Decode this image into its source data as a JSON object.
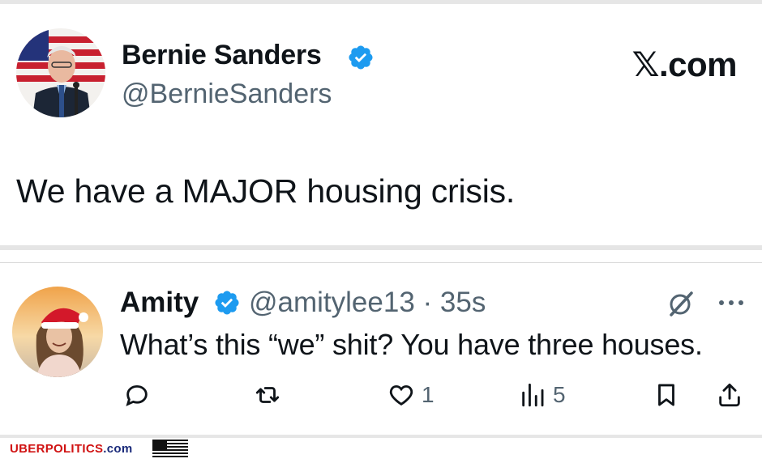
{
  "brand": {
    "x_logo": "𝕏.com"
  },
  "tweet": {
    "author_name": "Bernie Sanders",
    "author_handle": "@BernieSanders",
    "text": "We have a MAJOR housing crisis."
  },
  "reply": {
    "author_name": "Amity",
    "author_handle": "@amitylee13 · 35s",
    "text": "What’s this “we” shit? You have three houses.",
    "likes": "1",
    "views": "5"
  },
  "watermark": {
    "part1": "UBERPOLITICS",
    "part2": ".com"
  },
  "colors": {
    "verified": "#1d9bf0",
    "text": "#0f1419",
    "secondary": "#536471",
    "watermark_red": "#d01212",
    "watermark_blue": "#1a2a7a"
  },
  "icons": [
    "verified-badge-icon",
    "grok-icon",
    "more-icon",
    "reply-icon",
    "retweet-icon",
    "like-icon",
    "views-icon",
    "bookmark-icon",
    "share-icon",
    "us-flag-icon"
  ]
}
